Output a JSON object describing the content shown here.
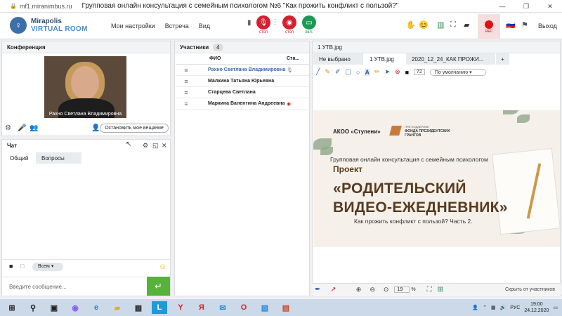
{
  "browser": {
    "url": "mf1.miranimbus.ru",
    "title": "Групповая онлайн консультация с семейным психологом №6 \"Как прожить конфликт с пользой?\""
  },
  "logo": {
    "line1": "Mirapolis",
    "line2": "VIRTUAL ROOM"
  },
  "menu": [
    "Мои настройки",
    "Встреча",
    "Вид"
  ],
  "controls": {
    "mic_label": "стоп",
    "cam_label": "стоп",
    "screen_label": "вкл.",
    "rec_label": "REC",
    "exit": "Выход"
  },
  "conference": {
    "title": "Конференция",
    "video_caption": "Рахно Светлана  Владимировна",
    "stop_broadcast": "Остановить мое вещание"
  },
  "chat": {
    "title": "Чат",
    "tabs": [
      "Общий",
      "Вопросы"
    ],
    "recipient": "Всем",
    "placeholder": "Введите сообщение..."
  },
  "participants": {
    "title": "Участники",
    "count": "4",
    "col_name": "ФИО",
    "col_status": "Ста...",
    "rows": [
      "Рахно Светлана  Владимировна",
      "Малкина Татьяна  Юрьевна",
      "Старцева  Светлана",
      "Маркина Валентина  Андреевна"
    ]
  },
  "board": {
    "title": "1 УТВ.jpg",
    "tabs": [
      "Не выбрано",
      "1 УТВ.jpg",
      "2020_12_24_КАК ПРОЖИ...",
      "+"
    ],
    "font_size": "72",
    "font_default": "По умолчанию",
    "zoom": "19",
    "zoom_unit": "%",
    "hide": "Скрыть от участников"
  },
  "slide": {
    "org": "АКОО «Ступени»",
    "support_small": "ПРИ ПОДДЕРЖКЕ",
    "fund": "ФОНДА ПРЕЗИДЕНТСКИХ ГРАНТОВ",
    "subtitle": "Групповая онлайн консультация с семейным психологом",
    "project": "Проект",
    "title1": "«РОДИТЕЛЬСКИЙ",
    "title2": "ВИДЕО-ЕЖЕДНЕВНИК»",
    "caption": "Как прожить конфликт с пользой? Часть 2."
  },
  "taskbar": {
    "lang": "РУС",
    "time": "19:00",
    "date": "24.12.2020"
  },
  "colors": {
    "accent": "#4a8ac7",
    "stop": "#d42030",
    "ok": "#1a9a55",
    "send": "#56b33a",
    "title": "#5a3b1e"
  }
}
